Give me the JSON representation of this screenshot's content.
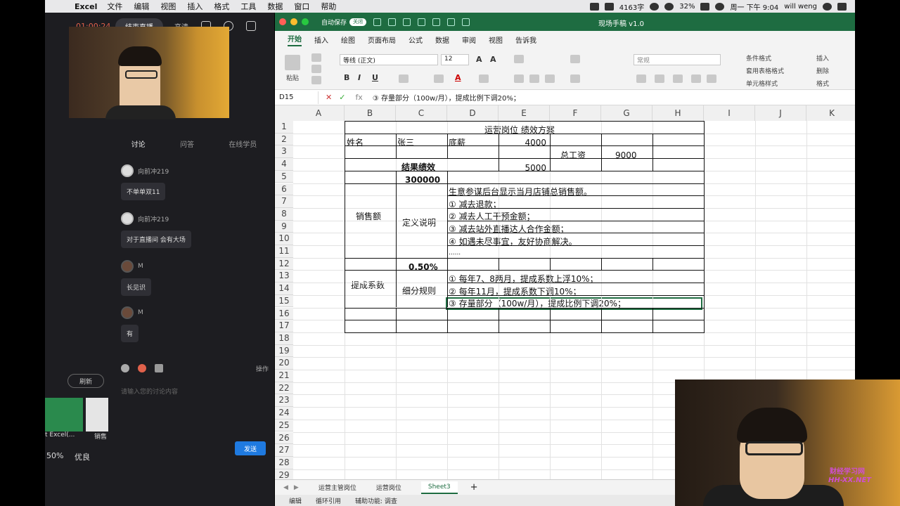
{
  "menubar": {
    "app_name": "Excel",
    "items": [
      "文件",
      "编辑",
      "视图",
      "插入",
      "格式",
      "工具",
      "数据",
      "窗口",
      "帮助"
    ],
    "word_count": "4163字",
    "battery": "32%",
    "clock": "周一 下午 9:04",
    "user": "will weng"
  },
  "live": {
    "timer": "01:00:24",
    "end_button": "结束直播",
    "quality": "高清",
    "tabs": [
      "讨论",
      "问答",
      "在线学员"
    ],
    "messages": [
      {
        "user": "向前冲219",
        "text": "不单单双11"
      },
      {
        "user": "向前冲219",
        "text": "对于直播间 会有大场"
      },
      {
        "user": "M",
        "text": "长见识"
      },
      {
        "user": "M",
        "text": "有"
      }
    ],
    "ops_label": "操作",
    "refresh": "刷新",
    "input_placeholder": "请输入您的讨论内容",
    "send": "发送",
    "thumb1_label": "t Excel(...",
    "thumb2_label": "销售",
    "status_pct": "50%",
    "status_quality": "优良"
  },
  "excel": {
    "title": "现场手稿 v1.0",
    "autosave": "自动保存",
    "autosave_state": "关闭",
    "ribbon_tabs": [
      "开始",
      "插入",
      "绘图",
      "页面布局",
      "公式",
      "数据",
      "审阅",
      "视图",
      "告诉我"
    ],
    "font_name": "等线 (正文)",
    "font_size": "12",
    "number_format": "常规",
    "paste_label": "粘贴",
    "styles": [
      "条件格式",
      "套用表格格式",
      "单元格样式"
    ],
    "cells_group": [
      "插入",
      "删除",
      "格式"
    ],
    "name_box": "D15",
    "formula": "③ 存量部分（100w/月），提成比例下调20%；",
    "columns": [
      "A",
      "B",
      "C",
      "D",
      "E",
      "F",
      "G",
      "H",
      "I",
      "J",
      "K"
    ],
    "rows": [
      "1",
      "2",
      "3",
      "4",
      "5",
      "6",
      "7",
      "8",
      "9",
      "10",
      "11",
      "12",
      "13",
      "14",
      "15",
      "16",
      "17",
      "18",
      "19",
      "20",
      "21",
      "22",
      "23",
      "24",
      "25",
      "26",
      "27",
      "28",
      "29"
    ],
    "cells": {
      "title": "运营岗位 绩效方案",
      "name_label": "姓名",
      "name_value": "张三",
      "base_label": "底薪",
      "base_value": "4000",
      "total_label": "总工资",
      "total_value": "9000",
      "perf_label": "结果绩效",
      "perf_value": "5000",
      "sales_label": "销售额",
      "sales_value": "300000",
      "def_label": "定义说明",
      "def_lines": [
        "生意参谋后台显示当月店铺总销售额。",
        "① 减去退款；",
        "② 减去人工干预金额；",
        "③ 减去站外直播达人合作金额；",
        "④ 如遇未尽事宜，友好协商解决。",
        "......"
      ],
      "rate_value": "0.50%",
      "rate_label": "提成系数",
      "rule_label": "细分规则",
      "rule_lines": [
        "① 每年7、8两月，提成系数上浮10%；",
        "② 每年11月，提成系数下调10%；",
        "③ 存量部分（100w/月），提成比例下调20%；"
      ]
    },
    "sheets": [
      "运营主管岗位",
      "运营岗位",
      "Sheet3"
    ],
    "status": [
      "编辑",
      "循环引用",
      "辅助功能: 调查"
    ]
  },
  "watermark": {
    "line1": "财经学习网",
    "line2": "HH-XX.NET"
  }
}
